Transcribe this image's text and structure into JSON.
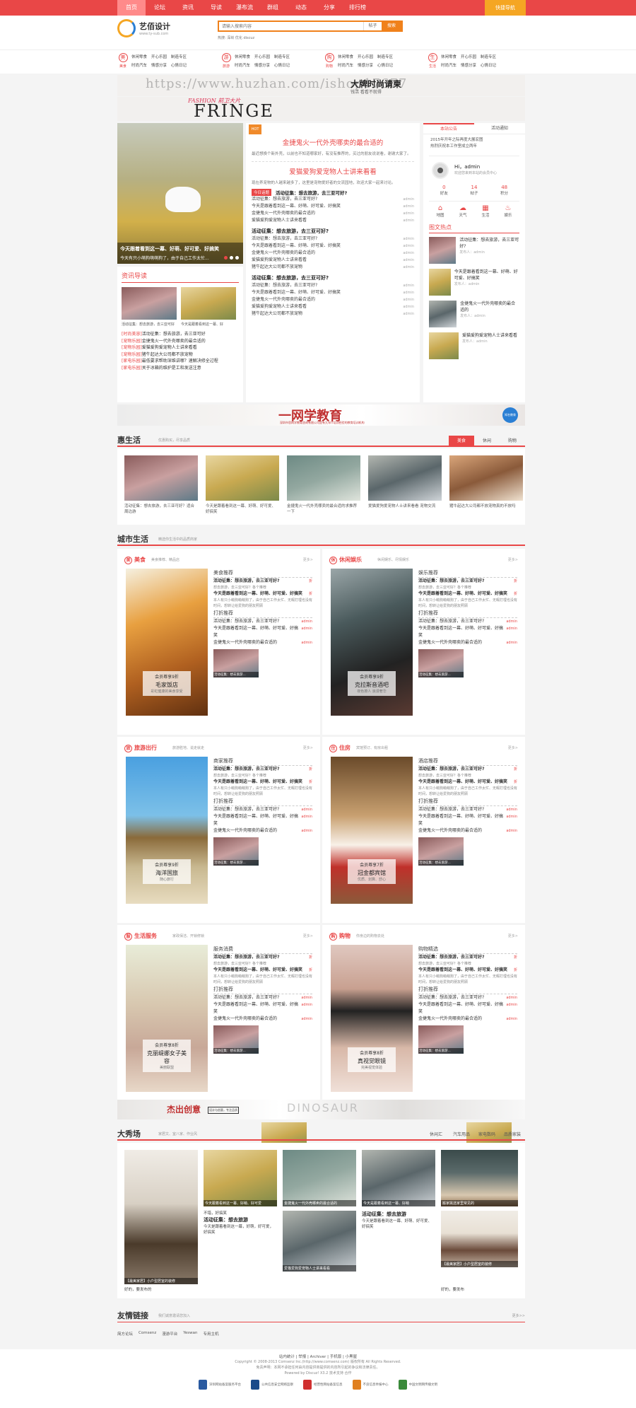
{
  "nav": {
    "items": [
      "首页",
      "论坛",
      "资讯",
      "导读",
      "瀑布流",
      "群组",
      "动态",
      "分享",
      "排行榜"
    ],
    "quick": "快捷导航"
  },
  "logo": {
    "title": "艺佰设计",
    "sub": "www.ty-sub.com"
  },
  "search": {
    "placeholder": "请输入搜索内容",
    "select": "帖子",
    "button": "搜索",
    "hot": "热搜: 深圳  优化  discuz"
  },
  "cats": [
    {
      "icon": "美",
      "label": "美食",
      "items": [
        "休闲零食",
        "开心乐园",
        "制造专区",
        "时尚汽车",
        "情感分享",
        "心情日记"
      ]
    },
    {
      "icon": "游",
      "label": "旅游",
      "items": [
        "休闲零食",
        "开心乐园",
        "制造专区",
        "时尚汽车",
        "情感分享",
        "心情日记"
      ]
    },
    {
      "icon": "购",
      "label": "购物",
      "items": [
        "休闲零食",
        "开心乐园",
        "制造专区",
        "时尚汽车",
        "情感分享",
        "心情日记"
      ]
    },
    {
      "icon": "生",
      "label": "生活",
      "items": [
        "休闲零食",
        "开心乐园",
        "制造专区",
        "时尚汽车",
        "情感分享",
        "心情日记"
      ]
    }
  ],
  "banner1": {
    "watermark": "https://www.huzhan.com/ishop17677",
    "title": "大牌时尚请柬",
    "sub": "钱活  看看不就得"
  },
  "banner2": {
    "big": "FRINGE",
    "small": "FASHION 前卫大片"
  },
  "slide": {
    "caption1": "今天跟着看到这一幕、好萌、好可爱、好搞笑",
    "caption2": "今天有只小萌狗萌萌狗了，由于自己工作太忙..."
  },
  "guide": {
    "title": "资讯导读",
    "caps": [
      "活动征集：想去旅游，去三亚可好",
      "今天是跟着看到这一幕、好"
    ],
    "list": [
      {
        "tag": "[时尚美容]",
        "text": "活动征集：想去旅游，去三亚可好"
      },
      {
        "tag": "[宠物乐园]",
        "text": "金捷鬼火一代外壳哪卖的最合适的"
      },
      {
        "tag": "[宠物乐园]",
        "text": "爱猫爱狗爱宠物人士讲来看看"
      },
      {
        "tag": "[宠物乐园]",
        "text": "猪牛起达大公司都不放宠物"
      },
      {
        "tag": "[家电乐园]",
        "text": "最低要求帮助深维讲哪？速解决修全过程"
      },
      {
        "tag": "[家电乐园]",
        "text": "关于冰箱的维护是工和发送注意"
      }
    ]
  },
  "center": {
    "hot": "HOT",
    "h1": "金捷鬼火一代外壳哪卖的最合适的",
    "d1": "最近想换个新外壳，以前也不知道哪家好，有没有推荐的，买过的朋友说说看，谢谢大家了。",
    "h2": "爱猫爱狗爱宠物人士讲来看看",
    "d2": "现在养宠物的人越来越多了，这里是宠物爱好者的交流园地，欢迎大家一起来讨论。",
    "tag": "今日话题",
    "topic": "活动征集：想去旅游，去三亚可好?",
    "groups": [
      {
        "head": null,
        "rows": [
          "活动征集：想去旅游，去三亚可好?",
          "今天是跟着看到这一幕、好萌、好可爱、好搞笑",
          "金捷鬼火一代外壳哪卖的最合适的",
          "爱猫爱狗爱宠物人士讲来看看"
        ]
      },
      {
        "head": "活动征集：想去旅游，去三亚可好?",
        "rows": [
          "活动征集：想去旅游，去三亚可好?",
          "今天是跟着看到这一幕、好萌、好可爱、好搞笑",
          "金捷鬼火一代外壳哪卖的最合适的",
          "爱猫爱狗爱宠物人士讲来看看",
          "猪牛起达大公司都不放宠物"
        ]
      },
      {
        "head": "活动征集：想去旅游，去三亚可好?",
        "rows": [
          "活动征集：想去旅游，去三亚可好?",
          "今天是跟着看到这一幕、好萌、好可爱、好搞笑",
          "金捷鬼火一代外壳哪卖的最合适的",
          "爱猫爱狗爱宠物人士讲来看看",
          "猪牛起达大公司都不放宠物"
        ]
      }
    ],
    "author": "admin"
  },
  "right": {
    "tabs": [
      "本站公告",
      "活动通知"
    ],
    "notices": [
      "2015年开年之际再度大展宏图",
      "热烈庆祝本工作室成立两年"
    ],
    "user": {
      "name": "Hi，admin",
      "info": "欢迎您来到本站的会员中心"
    },
    "stats": [
      {
        "n": "0",
        "l": "好友"
      },
      {
        "n": "14",
        "l": "帖子"
      },
      {
        "n": "48",
        "l": "积分"
      }
    ],
    "icons": [
      {
        "i": "⌂",
        "l": "地图"
      },
      {
        "i": "☁",
        "l": "天气"
      },
      {
        "i": "▦",
        "l": "生活"
      },
      {
        "i": "♨",
        "l": "娱乐"
      }
    ],
    "pictitle": "图文热点",
    "pics": [
      {
        "t": "活动征集：想去旅游，去三亚可好?",
        "a": "发布人：admin"
      },
      {
        "t": "今天是跟着看到这一幕、好萌、好可爱、好搞笑",
        "a": "发布人：admin"
      },
      {
        "t": "金捷鬼火一代外壳哪卖的最合适的",
        "a": "发布人：admin"
      },
      {
        "t": "爱猫爱狗爱宠物人士讲来看看",
        "a": "发布人：admin"
      }
    ]
  },
  "ad": {
    "title": "一网学教育",
    "sub": "深圳市思网学教育咨询有限公司是有九年IT培训经验的教育培训机构",
    "badge": "知名教育"
  },
  "huisheng": {
    "title": "惠生活",
    "sub": "优惠购买，尽享品质",
    "tabs": [
      "美食",
      "休闲",
      "购物"
    ],
    "items": [
      "活动征集：想去旅游，去三亚可好？适合周边游",
      "今天是跟着看到这一幕、好萌、好可爱、好搞笑",
      "金捷鬼火一代外壳哪卖的最合适的求推荐一下",
      "爱猫爱狗爱宠物人士讲来看看 宠物交流",
      "猪牛起达大公司都不放宠物真的不放吗"
    ]
  },
  "city": {
    "title": "城市生活",
    "sub": "精选你生活中的品质商家",
    "more": "更多>",
    "boxes": [
      {
        "icon": "美",
        "name": "美食",
        "sub": "美食推荐、精品店",
        "h1": "美食推荐",
        "h2": "打折推荐",
        "img": "会员尊享9折",
        "shop": "毛家饭店",
        "slogan": "彩虹健康的美食享受"
      },
      {
        "icon": "休",
        "name": "休闲娱乐",
        "sub": "休闲娱乐、尽情娱乐",
        "h1": "娱乐推荐",
        "h2": "打折推荐",
        "img": "会员尊享9折",
        "shop": "克拉斯音酒吧",
        "slogan": "夜色撩人  浪漫奢华"
      },
      {
        "icon": "旅",
        "name": "旅游出行",
        "sub": "旅游胜地、说走就走",
        "h1": "商家推荐",
        "h2": "打折推荐",
        "img": "会员尊享9折",
        "shop": "海洋国旅",
        "slogan": "随心旅行"
      },
      {
        "icon": "住",
        "name": "住房",
        "sub": "宾馆预订、有房出租",
        "h1": "酒店推荐",
        "h2": "打折推荐",
        "img": "会员尊享7折",
        "shop": "冠金都宾馆",
        "slogan": "优质、划算、舒心"
      },
      {
        "icon": "服",
        "name": "生活服务",
        "sub": "家政保洁、开锁修锁",
        "h1": "服务消费",
        "h2": "打折推荐",
        "img": "会员尊享8折",
        "shop": "克丽缇娜女子美容",
        "slogan": "美丽联盟"
      },
      {
        "icon": "购",
        "name": "购物",
        "sub": "你身边的购物去处",
        "h1": "购物精选",
        "h2": "打折推荐",
        "img": "会员尊享8折",
        "shop": "真视觉眼镜",
        "slogan": "完美视觉体验"
      }
    ],
    "r1": "活动征集：想去旅游，去三亚可好?",
    "r1d": "想去旅游，去三亚可好？各个推荐",
    "r2": "今天是跟着看到这一幕、好萌、好可爱、好搞笑",
    "r2d": "本人有只小萌狗萌萌狗了，由于自己工作太忙、无暇打理也没有时间，想转让给爱狗的朋友照顾",
    "d1": "活动征集：想去旅游，去三亚可好?",
    "d2": "今天是跟着看到这一幕、好萌、好可爱、好搞笑",
    "d3": "金捷鬼火一代外壳哪卖的最合适的",
    "author": "admin",
    "disc": "折",
    "pic1": "活动征集：想去旅游...",
    "pic2": "今天是跟着看到这一..."
  },
  "banner3": {
    "title": "杰出创意",
    "sub": "设计与创意，专注品质",
    "deco": "DINOSAUR"
  },
  "show": {
    "title": "大秀场",
    "sub": "家居文、室八家、作业风",
    "tabs": [
      "休闲汇",
      "汽车用品",
      "家电数码",
      "品质家装"
    ],
    "caps": [
      "今天跟着看到这一幕、好萌、好可爱",
      "金捷鬼火一代外壳哪卖的最合适的",
      "今天是跟着看到这一幕、好萌",
      "爱猫爱狗爱宠物人士讲来看看",
      "【最美家居】小户型居室的装修",
      "【最美家居】小户型居室的装修",
      "搬家挑选家里常见的"
    ],
    "t1": "活动征集：想去旅游",
    "t1d": "不错，好搞笑",
    "t2": "活动征集：想去旅游",
    "t2d": "今天是跟着看到这一幕，好萌，好可爱，好搞笑",
    "t3": "活动征集：想去旅游",
    "t3d": "今天是跟着看到这一幕、好萌、好可爱、好搞笑",
    "author1": "好的，要发布的",
    "author2": "好的，要发布"
  },
  "friend": {
    "title": "友情链接",
    "sub": "我们诚意邀请您加入",
    "more": "更多>>",
    "links": [
      "简方论坛",
      "Comsenz",
      "漫游平台",
      "Yeswan",
      "专用主机"
    ]
  },
  "footer": {
    "links": "站内统计 | 举报 | Archiver | 手机版 | 小黑屋",
    "copy": "Copyright © 2008-2013 Comsenz Inc.(http://www.comsenz.com) 版权所有 All Rights Reserved.",
    "icp": "免责声明：本网不承担任何由内容提供商提供的内容所引起的争议和法律责任。",
    "power": "Powered by Discuz! X3.2  技术支持  合作",
    "badges": [
      "深圳网站备案服务平台",
      "公共信息安全网络监察",
      "经营性网站备案信息",
      "不良信息举报中心",
      "中国文明网传播文明"
    ]
  }
}
